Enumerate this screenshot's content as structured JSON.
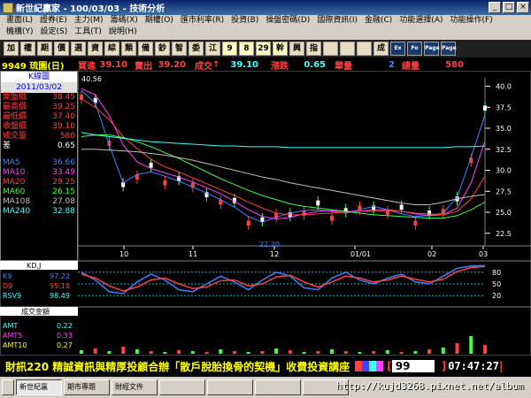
{
  "window": {
    "title": "新世紀贏家 - 100/03/03 - 技術分析"
  },
  "menu": {
    "row1": [
      "畫面(L)",
      "證券(E)",
      "主力(M)",
      "籌碼(X)",
      "期權(O)",
      "匯市利率(R)",
      "投資(B)",
      "操盤密碼(D)",
      "國際資訊(I)",
      "金融(C)",
      "功能選擇(A)",
      "功能操作(F)"
    ],
    "row2": [
      "機構(Y)",
      "設定(S)",
      "工具(T)",
      "說明(H)"
    ]
  },
  "toolbar": [
    "加",
    "權",
    "期",
    "價",
    "選",
    "資",
    "綜",
    "類",
    "備",
    "鈔",
    "智",
    "委",
    "江",
    "9",
    "8",
    "29",
    "幹",
    "興",
    "指",
    "",
    "",
    "",
    "成",
    "Ex",
    "Fo",
    "Page",
    "Page"
  ],
  "quote": {
    "code_name": "9949 琉園(日)",
    "buy_label": "買進",
    "buy": "39.10",
    "sell_label": "賣出",
    "sell": "39.20",
    "trade_label": "成交",
    "trade": "39.10",
    "change_label": "漲跌",
    "change": "0.65",
    "lot_label": "單量",
    "lot": "2",
    "total_label": "總量",
    "total": "580"
  },
  "panel": {
    "title": "K線圖",
    "date": "2011/03/02",
    "rows": [
      {
        "k": "開盤價",
        "v": "38.45",
        "c": "#ff4040"
      },
      {
        "k": "最高價",
        "v": "39.25",
        "c": "#ff4040"
      },
      {
        "k": "最低價",
        "v": "37.40",
        "c": "#ff4040"
      },
      {
        "k": "收盤價",
        "v": "39.10",
        "c": "#ff4040"
      },
      {
        "k": "成交量",
        "v": "580",
        "c": "#ff4040"
      },
      {
        "k": "差",
        "v": "0.65",
        "c": "#ffffff"
      }
    ],
    "ma": [
      {
        "k": "MA5",
        "v": "36.66",
        "c": "#4080ff"
      },
      {
        "k": "MA10",
        "v": "33.49",
        "c": "#ff40ff"
      },
      {
        "k": "MA20",
        "v": "29.25",
        "c": "#ff4040"
      },
      {
        "k": "MA60",
        "v": "26.15",
        "c": "#40ff40"
      },
      {
        "k": "MA108",
        "v": "27.08",
        "c": "#c0c0c0"
      },
      {
        "k": "MA240",
        "v": "32.88",
        "c": "#40ffff"
      }
    ]
  },
  "chart": {
    "high_label": "40.56",
    "low_label": "22.20",
    "y_ticks": [
      "40.0",
      "37.5",
      "35.0",
      "32.5",
      "30.0",
      "27.5",
      "25.0",
      "22.5"
    ],
    "x_ticks": [
      "10",
      "11",
      "12",
      "01/01",
      "02",
      "03"
    ]
  },
  "kd": {
    "title": "KD,J",
    "rows": [
      {
        "k": "K9",
        "v": "97.22",
        "c": "#4080ff"
      },
      {
        "k": "D9",
        "v": "95.18",
        "c": "#ff4040"
      },
      {
        "k": "RSV9",
        "v": "98.49",
        "c": "#40ffff"
      }
    ],
    "y_ticks": [
      "80",
      "50",
      "20"
    ]
  },
  "vol": {
    "title": "成交金額",
    "rows": [
      {
        "k": "AMT",
        "v": "0.22",
        "c": "#40ffff"
      },
      {
        "k": "AMT5",
        "v": "0.33",
        "c": "#ff40ff"
      },
      {
        "k": "AMT10",
        "v": "0.27",
        "c": "#ffff00"
      }
    ]
  },
  "ticker": {
    "text": "財訊220 精誠資訊與精厚投顧合辦「散戶脫胎換骨的契機」收費投資講座",
    "num": "99",
    "time": "07:47:27"
  },
  "taskbar": [
    "新世紀贏",
    "期市專題",
    "財經文件",
    "",
    "",
    "",
    ""
  ],
  "watermark": "http://kujd3268.pixnet.net/album",
  "chart_data": {
    "type": "line",
    "title": "",
    "x_ticks": [
      "10",
      "11",
      "12",
      "01/01",
      "02",
      "03"
    ],
    "ylim": [
      21,
      41
    ],
    "series": [
      {
        "name": "MA5",
        "values": [
          39.5,
          38,
          33,
          28.5,
          29.5,
          29.8,
          29.3,
          28.7,
          28,
          27.3,
          26.5,
          25.6,
          24.5,
          23.8,
          24.4,
          24.9,
          25.2,
          25.3,
          25.1,
          24.9,
          25.3,
          25.7,
          25.3,
          24.8,
          24.5,
          24.6,
          24.9,
          26.8,
          31.5,
          36.6
        ]
      },
      {
        "name": "MA10",
        "values": [
          39.7,
          39,
          36.5,
          33,
          31,
          30.2,
          29.7,
          29.2,
          28.6,
          27.9,
          27.2,
          26.3,
          25.3,
          24.5,
          24.2,
          24.4,
          24.8,
          25.1,
          25.2,
          25.1,
          25.1,
          25.3,
          25.3,
          25.1,
          24.8,
          24.6,
          24.7,
          25.5,
          28.5,
          33.5
        ]
      },
      {
        "name": "MA20",
        "values": [
          38.5,
          37.5,
          36,
          34,
          32.6,
          31.3,
          30.4,
          29.8,
          29.1,
          28.4,
          27.7,
          27,
          26.2,
          25.5,
          24.9,
          24.7,
          24.7,
          24.8,
          24.9,
          25,
          25.1,
          25.1,
          25.2,
          25.1,
          24.9,
          24.8,
          24.7,
          25.1,
          26.6,
          29.3
        ]
      },
      {
        "name": "MA60",
        "values": [
          34,
          34.2,
          34.2,
          33.9,
          33.4,
          32.8,
          32.1,
          31.4,
          30.6,
          29.8,
          29,
          28.3,
          27.6,
          27,
          26.5,
          26,
          25.7,
          25.5,
          25.3,
          25.1,
          24.9,
          24.7,
          24.6,
          24.5,
          24.4,
          24.3,
          24.3,
          24.6,
          25.3,
          26.2
        ]
      },
      {
        "name": "MA108",
        "values": [
          32.5,
          32.5,
          32.4,
          32.3,
          32.2,
          32,
          31.8,
          31.5,
          31.2,
          30.8,
          30.4,
          30,
          29.6,
          29.2,
          28.9,
          28.5,
          28.2,
          27.9,
          27.6,
          27.3,
          27,
          26.7,
          26.4,
          26.1,
          25.9,
          25.9,
          26.2,
          26.6,
          26.9,
          27.1
        ]
      },
      {
        "name": "MA240",
        "values": [
          34.5,
          34.2,
          34,
          33.8,
          33.6,
          33.4,
          33.3,
          33.2,
          33.1,
          33,
          32.9,
          32.9,
          32.8,
          32.8,
          32.8,
          32.7,
          32.7,
          32.7,
          32.7,
          32.7,
          32.7,
          32.7,
          32.7,
          32.7,
          32.7,
          32.7,
          32.7,
          32.8,
          32.8,
          32.9
        ]
      },
      {
        "name": "K9",
        "values": [
          80,
          60,
          30,
          25,
          55,
          75,
          60,
          35,
          30,
          50,
          70,
          55,
          35,
          60,
          80,
          70,
          40,
          35,
          65,
          80,
          60,
          50,
          65,
          75,
          55,
          50,
          70,
          90,
          96,
          97
        ]
      },
      {
        "name": "D9",
        "values": [
          75,
          65,
          45,
          32,
          42,
          60,
          65,
          50,
          38,
          42,
          58,
          60,
          45,
          50,
          68,
          72,
          55,
          42,
          55,
          70,
          65,
          55,
          60,
          70,
          62,
          55,
          62,
          82,
          92,
          95
        ]
      }
    ]
  }
}
